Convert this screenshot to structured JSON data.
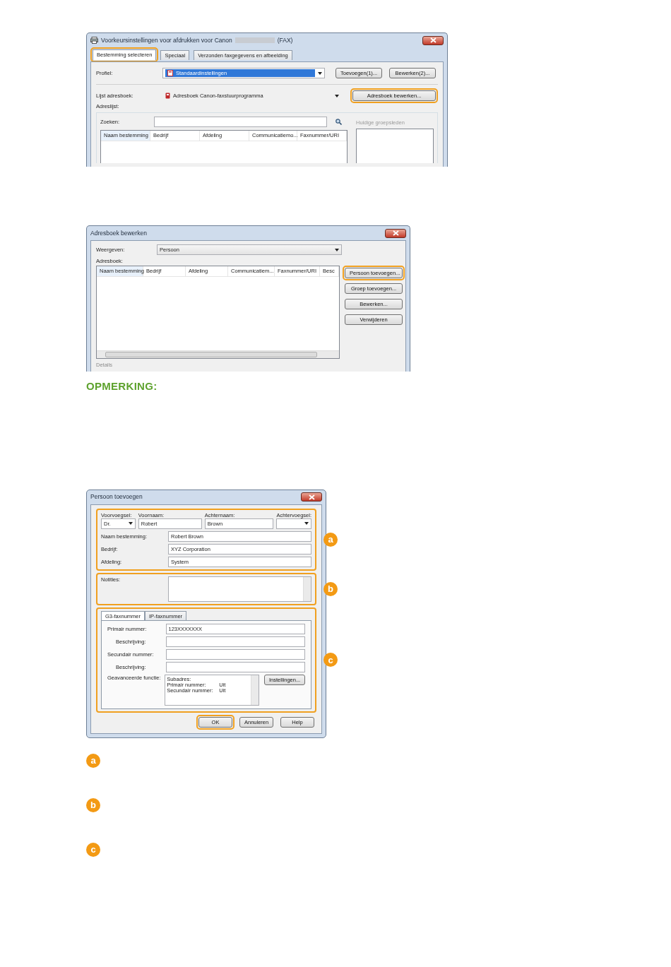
{
  "print_window": {
    "title": "Voorkeursinstellingen voor afdrukken voor Canon",
    "title_suffix": "(FAX)",
    "tabs": [
      {
        "label": "Bestemming selecteren",
        "selected": true,
        "highlighted": true
      },
      {
        "label": "Speciaal",
        "selected": false,
        "highlighted": false
      },
      {
        "label": "Verzonden faxgegevens en afbeelding",
        "selected": false,
        "highlighted": false
      }
    ],
    "profile": {
      "label": "Profiel:",
      "value": "Standaardinstellingen"
    },
    "profile_buttons": [
      {
        "label": "Toevoegen(1)...",
        "highlighted": false
      },
      {
        "label": "Bewerken(2)...",
        "highlighted": false
      }
    ],
    "address_book_list": {
      "label": "Lijst adresboek:",
      "value": "Adresboek Canon-faxstuurprogramma"
    },
    "address_book_button": {
      "label": "Adresboek bewerken...",
      "highlighted": true
    },
    "address_list_label": "Adreslijst:",
    "search": {
      "label": "Zoeken:"
    },
    "columns": [
      "Naam bestemming",
      "Bedrijf",
      "Afdeling",
      "Communicatiemo...",
      "Faxnummer/URI"
    ],
    "group_members_label": "Huidige groepsleden"
  },
  "address_book_window": {
    "title": "Adresboek bewerken",
    "view": {
      "label": "Weergeven:",
      "value": "Persoon"
    },
    "address_book_label": "Adresboek:",
    "columns": [
      "Naam bestemming",
      "Bedrijf",
      "Afdeling",
      "Communicatiem...",
      "Faxnummer/URI",
      "Besc"
    ],
    "buttons": [
      {
        "label": "Persoon toevoegen...",
        "highlighted": true
      },
      {
        "label": "Groep toevoegen...",
        "highlighted": false
      },
      {
        "label": "Bewerken...",
        "highlighted": false
      },
      {
        "label": "Verwijderen",
        "highlighted": false
      }
    ],
    "details_label": "Details"
  },
  "note_heading": "OPMERKING:",
  "add_person_window": {
    "title": "Persoon toevoegen",
    "groups": [
      {
        "kind": "name",
        "callout": "a",
        "highlighted": true,
        "name_fields": [
          {
            "kind": "select",
            "label": "Voorvoegsel:",
            "value": "Dr."
          },
          {
            "kind": "text",
            "label": "Voornaam:",
            "value": "Robert"
          },
          {
            "kind": "text",
            "label": "Achternaam:",
            "value": "Brown"
          },
          {
            "kind": "select",
            "label": "Achtervoegsel:"
          }
        ],
        "fields": [
          {
            "label": "Naam bestemming:",
            "value": "Robert Brown"
          },
          {
            "label": "Bedrijf:",
            "value": "XYZ Corporation"
          },
          {
            "label": "Afdeling:",
            "value": "System"
          }
        ]
      },
      {
        "kind": "notes",
        "callout": "b",
        "highlighted": true,
        "label": "Notities:"
      },
      {
        "kind": "fax",
        "callout": "c",
        "highlighted": true,
        "tabs": [
          {
            "label": "G3-faxnummer",
            "selected": true
          },
          {
            "label": "IP-faxnummer",
            "selected": false
          }
        ],
        "fields": [
          {
            "label": "Primair nummer:",
            "value": "123XXXXXXX",
            "indented": false
          },
          {
            "label": "Beschrijving:",
            "indented": true
          },
          {
            "label": "Secundair nummer:",
            "indented": false
          },
          {
            "label": "Beschrijving:",
            "indented": true
          }
        ],
        "advanced": {
          "label": "Geavanceerde functie:",
          "lines": [
            {
              "label": "Subadres:"
            },
            {
              "label": "Primair nummer:",
              "value": "Uit"
            },
            {
              "label": "Secundair nummer:",
              "value": "Uit"
            }
          ],
          "button": "Instellingen..."
        }
      }
    ],
    "buttons": [
      {
        "label": "OK",
        "highlighted": true
      },
      {
        "label": "Annuleren",
        "highlighted": false
      },
      {
        "label": "Help",
        "highlighted": false
      }
    ]
  },
  "callouts": [
    {
      "label": "a"
    },
    {
      "label": "b"
    },
    {
      "label": "c"
    }
  ]
}
